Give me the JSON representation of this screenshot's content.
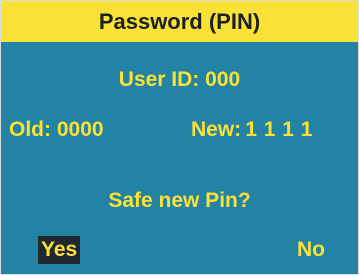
{
  "header": {
    "title": "Password (PIN)"
  },
  "body": {
    "user_id_label": "User ID:",
    "user_id_value": "000",
    "old_label": "Old:",
    "old_value": "0000",
    "new_label": "New:",
    "new_value": "1111",
    "question": "Safe new Pin?"
  },
  "options": {
    "yes": "Yes",
    "no": "No",
    "selected": "Yes"
  },
  "colors": {
    "background": "#2283a4",
    "accent": "#fae136",
    "header_text": "#1c2128",
    "selection": "#1f2831"
  }
}
